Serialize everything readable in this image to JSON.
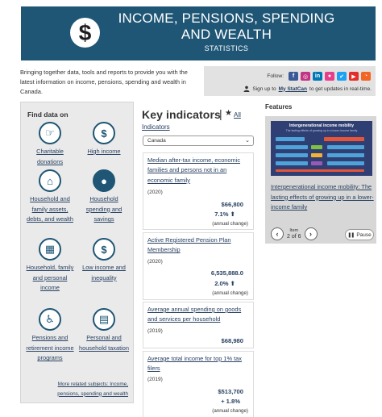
{
  "banner": {
    "title_line1": "INCOME, PENSIONS, SPENDING",
    "title_line2": "AND WEALTH",
    "subtitle": "STATISTICS",
    "icon": "dollar-icon"
  },
  "intro": {
    "text": "Bringing together data, tools and reports to provide you with the latest information on income, pensions, spending and wealth in Canada."
  },
  "follow": {
    "label": "Follow:",
    "networks": [
      {
        "name": "facebook-icon",
        "glyph": "f",
        "color": "#3b5998"
      },
      {
        "name": "instagram-icon",
        "glyph": "◎",
        "color": "#c13584"
      },
      {
        "name": "linkedin-icon",
        "glyph": "in",
        "color": "#0077b5"
      },
      {
        "name": "flickr-icon",
        "glyph": "●",
        "color": "#e83d8a"
      },
      {
        "name": "twitter-icon",
        "glyph": "✔",
        "color": "#1da1f2"
      },
      {
        "name": "youtube-icon",
        "glyph": "▶",
        "color": "#e52d27"
      },
      {
        "name": "rss-icon",
        "glyph": "◔",
        "color": "#f26522"
      }
    ],
    "signup_prefix": "Sign up to",
    "signup_link": "My StatCan",
    "signup_suffix": "to get updates in real-time."
  },
  "find_data": {
    "title": "Find data on",
    "subjects": [
      {
        "label": "Charitable donations",
        "icon": "donation-hand-icon",
        "glyph": "☞"
      },
      {
        "label": "High income",
        "icon": "dollar-icon",
        "glyph": "$"
      },
      {
        "label": "Household and family assets, debts, and wealth",
        "icon": "house-icon",
        "glyph": "⌂"
      },
      {
        "label": "Household spending and savings",
        "icon": "piggy-bank-icon",
        "glyph": "●"
      },
      {
        "label": "Household, family and personal income",
        "icon": "family-income-icon",
        "glyph": "▦"
      },
      {
        "label": "Low income and inequality",
        "icon": "low-income-icon",
        "glyph": "$"
      },
      {
        "label": "Pensions and retirement income programs",
        "icon": "pension-icon",
        "glyph": "♿"
      },
      {
        "label": "Personal and household taxation",
        "icon": "taxation-icon",
        "glyph": "▤"
      }
    ],
    "more_line1": "More related subjects: Income,",
    "more_line2": "pensions, spending and wealth"
  },
  "key_indicators": {
    "title": "Key indicators",
    "all_link": "All",
    "indicators_link": "Indicators",
    "select_value": "Canada",
    "cards": [
      {
        "name": "Median after-tax income, economic families and persons not in an economic family",
        "year": "(2020)",
        "value": "$66,800",
        "change": "7.1%",
        "arrow": "up",
        "change_label": "(annual change)"
      },
      {
        "name": "Active Registered Pension Plan Membership",
        "year": "(2020)",
        "value": "6,535,888.0",
        "change": "2.0%",
        "arrow": "up",
        "change_label": "(annual change)"
      },
      {
        "name": "Average annual spending on goods and services per household",
        "year": "(2019)",
        "value": "$68,980",
        "change": "",
        "arrow": "",
        "change_label": ""
      },
      {
        "name": "Average total income for top 1% tax filers",
        "year": "(2019)",
        "value": "$513,700",
        "change": "+ 1.8%",
        "arrow": "",
        "change_label": "(annual change)"
      }
    ]
  },
  "features": {
    "title": "Features",
    "image_title": "Intergenerational income mobility",
    "image_subtitle": "The lasting effects of growing up in a lower-income family",
    "caption": "Intergenerational income mobility: The lasting effects of growing up in a lower-income family",
    "item_label": "Item",
    "item_count": "2 of 6",
    "pause_label": "Pause"
  }
}
